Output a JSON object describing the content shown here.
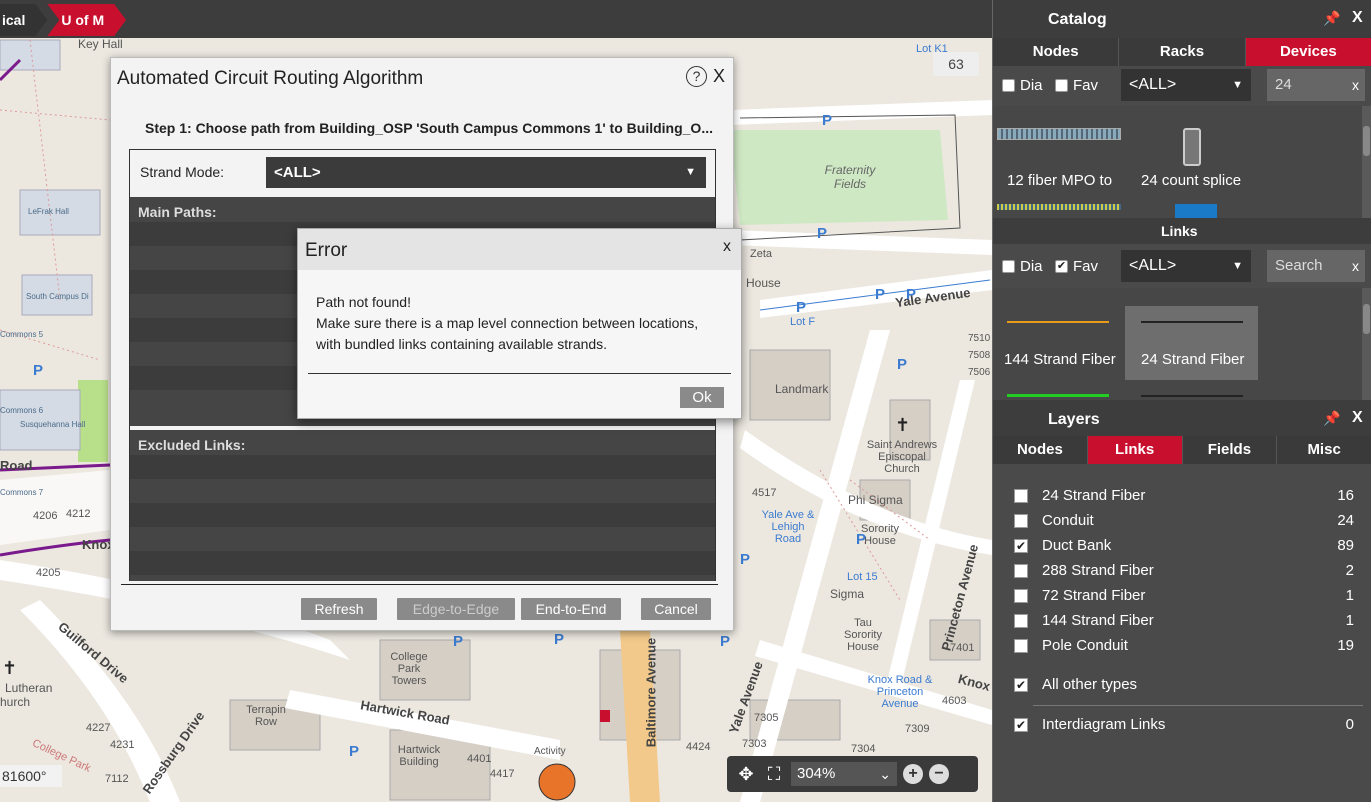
{
  "breadcrumb": [
    "ical",
    "U of M"
  ],
  "map": {
    "count_badge": "63",
    "scale_label": "81600°",
    "labels": [
      "Key Hall",
      "LeFrak Hall",
      "South Campus Di",
      "Commons 5",
      "Commons 6",
      "Susquehanna Hall",
      "Commons 7",
      "4206",
      "4212",
      "4205",
      "Fraternity Fields",
      "Zeta",
      "House",
      "Lot F",
      "Lot K1",
      "Landmark",
      "Saint Andrews Episcopal Church",
      "Phi Sigma",
      "Sorority House",
      "Yale Ave & Lehigh Road",
      "Lot 15",
      "Sigma",
      "Tau Sorority House",
      "Knox Road & Princeton Avenue",
      "College Park Towers",
      "Terrapin Row",
      "Hartwick Building",
      "Hartwick Road",
      "Activity",
      "Lutheran",
      "hurch",
      "4227",
      "4231",
      "7112",
      "4424",
      "7305",
      "7303",
      "7304",
      "7309",
      "4603",
      "7401",
      "4517",
      "4401",
      "4417",
      "Yale Avenue",
      "Guilford Drive",
      "College Park",
      "Rossburg Drive",
      "Baltimore Avenue",
      "Yale Avenue",
      "Princeton Avenue",
      "Knox",
      "Road",
      "Knox",
      "7510",
      "7508",
      "7506"
    ],
    "zoom": {
      "level": "304%"
    }
  },
  "routing_dialog": {
    "title": "Automated Circuit Routing Algorithm",
    "help": "?",
    "close": "X",
    "step": "Step 1: Choose path from Building_OSP 'South Campus Commons 1' to Building_O...",
    "strand_mode_label": "Strand Mode:",
    "strand_mode_value": "<ALL>",
    "main_paths_label": "Main Paths:",
    "excluded_links_label": "Excluded Links:",
    "buttons": {
      "refresh": "Refresh",
      "edge_to_edge": "Edge-to-Edge",
      "end_to_end": "End-to-End",
      "cancel": "Cancel"
    }
  },
  "error_dialog": {
    "title": "Error",
    "close": "x",
    "line1": "Path not found!",
    "line2": "Make sure there is a map level connection between locations,",
    "line3": "with bundled links containing available strands.",
    "ok": "Ok"
  },
  "catalog": {
    "title": "Catalog",
    "tabs": [
      "Nodes",
      "Racks",
      "Devices"
    ],
    "active_tab": "Devices",
    "dia_label": "Dia",
    "fav_label": "Fav",
    "dia_checked": false,
    "fav_checked": false,
    "type_select": "<ALL>",
    "search_value": "24",
    "items": [
      "12 fiber MPO to",
      "24 count splice"
    ]
  },
  "links": {
    "title": "Links",
    "dia_label": "Dia",
    "fav_label": "Fav",
    "dia_checked": false,
    "fav_checked": true,
    "type_select": "<ALL>",
    "search_placeholder": "Search",
    "items": [
      "144 Strand Fiber",
      "24 Strand Fiber"
    ]
  },
  "layers": {
    "title": "Layers",
    "tabs": [
      "Nodes",
      "Links",
      "Fields",
      "Misc"
    ],
    "active_tab": "Links",
    "rows": [
      {
        "name": "24 Strand Fiber",
        "count": "16",
        "checked": false
      },
      {
        "name": "Conduit",
        "count": "24",
        "checked": false
      },
      {
        "name": "Duct Bank",
        "count": "89",
        "checked": true
      },
      {
        "name": "288 Strand Fiber",
        "count": "2",
        "checked": false
      },
      {
        "name": "72 Strand Fiber",
        "count": "1",
        "checked": false
      },
      {
        "name": "144 Strand Fiber",
        "count": "1",
        "checked": false
      },
      {
        "name": "Pole Conduit",
        "count": "19",
        "checked": false
      }
    ],
    "all_other_types": {
      "name": "All other types",
      "checked": true
    },
    "interdiagram": {
      "name": "Interdiagram Links",
      "count": "0",
      "checked": true
    }
  },
  "colors": {
    "accent": "#c8102e",
    "panel_bg": "#4a4a4a",
    "header_bg": "#3d3d3d"
  }
}
